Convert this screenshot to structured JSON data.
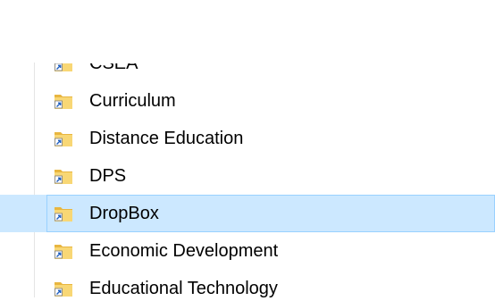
{
  "folder_list": {
    "items": [
      {
        "label": "CSEA",
        "icon": "folder-shortcut-icon",
        "selected": false
      },
      {
        "label": "Curriculum",
        "icon": "folder-shortcut-icon",
        "selected": false
      },
      {
        "label": "Distance Education",
        "icon": "folder-shortcut-icon",
        "selected": false
      },
      {
        "label": "DPS",
        "icon": "folder-shortcut-icon",
        "selected": false
      },
      {
        "label": "DropBox",
        "icon": "folder-shortcut-icon",
        "selected": true
      },
      {
        "label": "Economic Development",
        "icon": "folder-shortcut-icon",
        "selected": false
      },
      {
        "label": "Educational Technology",
        "icon": "folder-shortcut-icon",
        "selected": false
      }
    ]
  },
  "colors": {
    "selection_fill": "#cce8ff",
    "selection_border": "#99d1ff",
    "folder_yellow": "#f8d775",
    "shortcut_arrow": "#1f5fbf"
  }
}
